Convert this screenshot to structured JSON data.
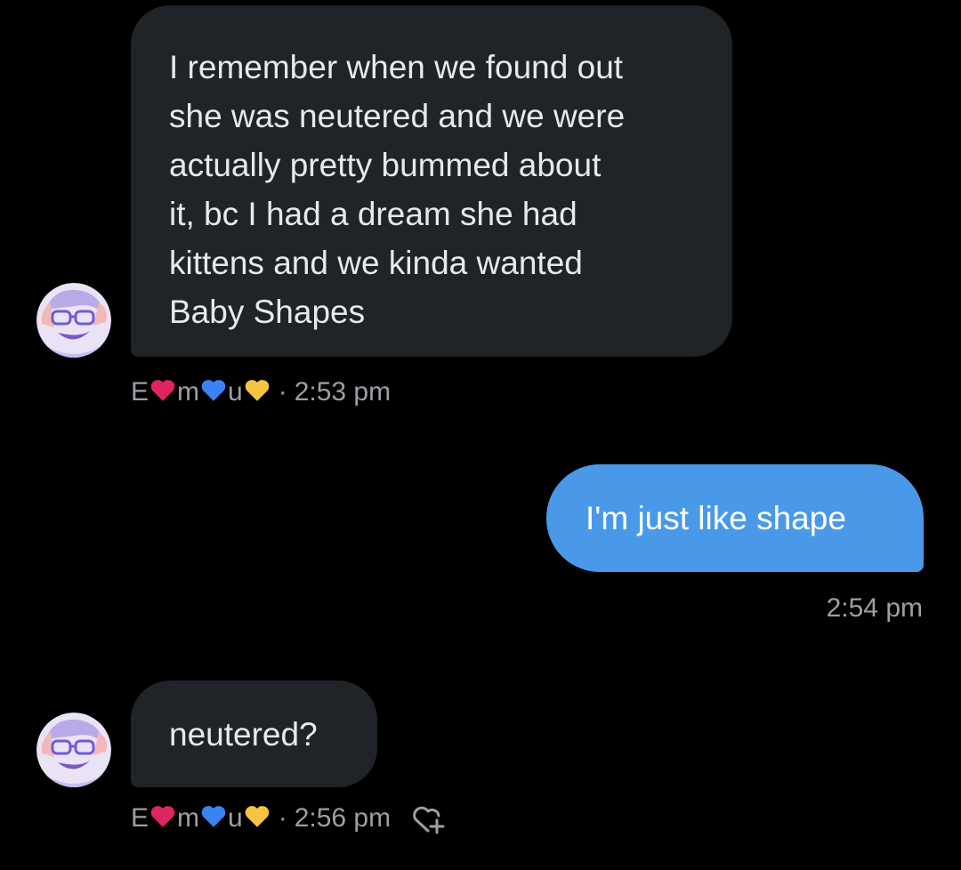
{
  "colors": {
    "background": "#000000",
    "incoming_bubble": "#202327",
    "outgoing_bubble": "#4a99e9",
    "meta_text": "#9aa0a6",
    "heart_red": "#e0245e",
    "heart_blue": "#3b82f6",
    "heart_yellow": "#f5c542"
  },
  "messages": [
    {
      "sender": "other",
      "text": "I remember when we found out\nshe was neutered and we were\nactually pretty bummed about\nit, bc I had a dream she had\nkittens and we kinda wanted\nBaby Shapes",
      "time": "2:53 pm"
    },
    {
      "sender": "me",
      "text": "I'm just like shape",
      "time": "2:54 pm"
    },
    {
      "sender": "other",
      "text": "neutered?",
      "time": "2:56 pm"
    }
  ],
  "sender_name_parts": [
    "E",
    "m",
    "u"
  ],
  "separator": "·",
  "icons": {
    "avatar": "avatar-illustration",
    "react": "heart-plus-icon"
  }
}
